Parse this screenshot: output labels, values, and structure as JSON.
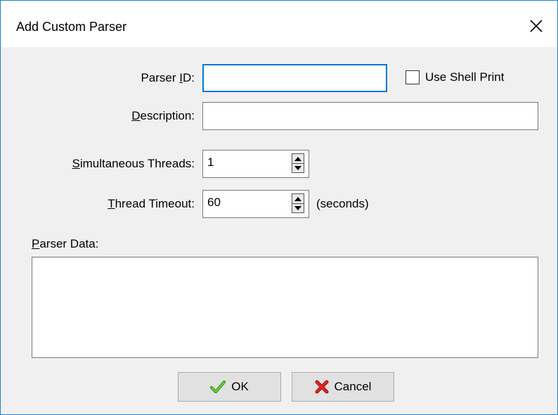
{
  "window": {
    "title": "Add Custom Parser"
  },
  "form": {
    "parser_id": {
      "label_pre": "Parser ",
      "label_key": "I",
      "label_post": "D:",
      "value": ""
    },
    "use_shell_print": {
      "label": "Use Shell Print",
      "checked": false
    },
    "description": {
      "label_key": "D",
      "label_post": "escription:",
      "value": ""
    },
    "threads": {
      "label_key": "S",
      "label_post": "imultaneous Threads:",
      "value": "1"
    },
    "timeout": {
      "label_key": "T",
      "label_post": "hread Timeout:",
      "value": "60",
      "unit": "(seconds)"
    },
    "parser_data": {
      "label_key": "P",
      "label_post": "arser Data:",
      "value": ""
    }
  },
  "buttons": {
    "ok": {
      "label": "OK",
      "icon": "checkmark-icon",
      "icon_color": "#3fb618"
    },
    "cancel": {
      "label": "Cancel",
      "icon": "x-icon",
      "icon_color": "#d81a1a"
    }
  },
  "colors": {
    "accent": "#0078d7",
    "window_border": "#1883d7"
  }
}
